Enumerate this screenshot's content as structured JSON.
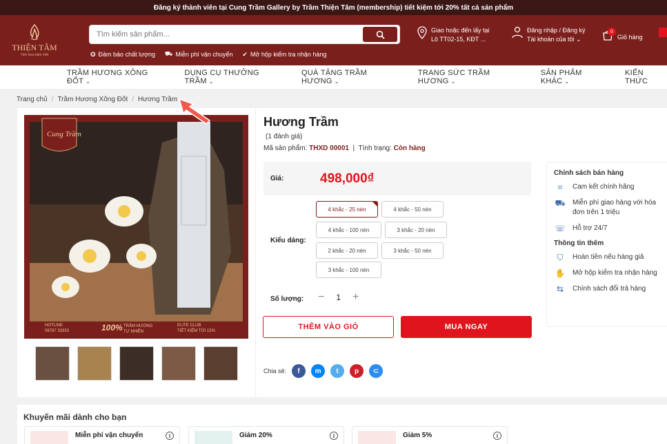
{
  "topbar": {
    "text": "Đăng ký thành viên tại Cung Trầm Gallery by Trầm Thiện Tâm (membership) tiết kiệm tới ",
    "highlight": "20%",
    "text_after": " tất cả sản phẩm"
  },
  "logo": {
    "name": "THIỆN TÂM",
    "tagline": "Tinh hoa trầm Việt"
  },
  "search": {
    "placeholder": "Tìm kiếm sản phẩm..."
  },
  "badges": [
    "Đảm bảo chất lượng",
    "Miễn phí vận chuyển",
    "Mở hộp kiểm tra nhận hàng"
  ],
  "delivery": {
    "line1": "Giao hoặc đến lấy tại",
    "line2": "Lô TT02-15, KĐT ..."
  },
  "account": {
    "line1": "Đăng nhập / Đăng ký",
    "line2": "Tài khoản của tôi"
  },
  "cart": {
    "label": "Giỏ hàng",
    "count": "0"
  },
  "nav": [
    "TRẦM HƯƠNG XÔNG ĐỐT",
    "DỤNG CỤ THƯỞNG TRẦM",
    "QUÀ TẶNG TRẦM HƯƠNG",
    "TRANG SỨC TRẦM HƯƠNG",
    "SẢN PHẨM KHÁC",
    "KIẾN THỨC"
  ],
  "breadcrumb": [
    "Trang chủ",
    "Trầm Hương Xông Đốt",
    "Hương Trầm"
  ],
  "product": {
    "title": "Hương Trầm",
    "rating": "(1 đánh giá)",
    "sku_label": "Mã sản phẩm:",
    "sku": "THXD 00001",
    "status_label": "Tình trạng:",
    "status": "Còn hàng",
    "price_label": "Giá:",
    "price": "498,000₫",
    "variant_label": "Kiểu dáng:",
    "variants": [
      "4 khắc - 25 nén",
      "4 khắc - 50 nén",
      "4 khắc - 100 nén",
      "3 khắc - 20 nén",
      "2 khắc - 20 nén",
      "3 khắc - 50 nén",
      "3 khắc - 100 nén"
    ],
    "qty_label": "Số lượng:",
    "qty": "1",
    "add_cart": "THÊM VÀO GIỎ",
    "buy_now": "MUA NGAY",
    "share_label": "Chia sẻ:"
  },
  "image_text": {
    "brand": "Cung Trầm",
    "hotline_label": "HOTLINE",
    "hotline": "08767 33333",
    "percent": "100%",
    "natural": "TRẦM HƯƠNG TỰ NHIÊN",
    "club": "ELITE CLUB",
    "club_sub": "TIẾT KIỆM TỚI 15%"
  },
  "policy": {
    "title1": "Chính sách bán hàng",
    "items1": [
      "Cam kết chính hãng",
      "Miễn phí giao hàng với hóa đơn trên 1 triệu",
      "Hỗ trợ 24/7"
    ],
    "title2": "Thông tin thêm",
    "items2": [
      "Hoàn tiền nếu hàng giả",
      "Mở hộp kiểm tra nhận hàng",
      "Chính sách đổi trả hàng"
    ]
  },
  "promo": {
    "title": "Khuyến mãi dành cho bạn",
    "cards": [
      "Miễn phí vận chuyển",
      "Giảm 20%",
      "Giảm 5%"
    ]
  },
  "colors": {
    "brand": "#7a1f1c",
    "accent": "#e0141c",
    "topbar": "#3a1715"
  }
}
